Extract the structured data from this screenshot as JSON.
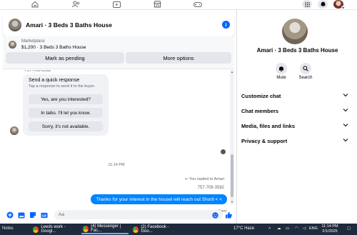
{
  "colors": {
    "accent": "#0866ff",
    "bubble_out": "#0084ff",
    "taskbar": "#1f2a3c",
    "muted": "#65676b",
    "button_bg": "#e4e6eb"
  },
  "topnav": {
    "icons": [
      "home-icon",
      "friends-icon",
      "video-icon",
      "marketplace-icon",
      "gaming-icon",
      "menu-grid-icon",
      "notifications-icon",
      "profile-avatar"
    ]
  },
  "chat": {
    "title": "Amari · 3 Beds 3 Baths House",
    "marketplace_label": "Marketplace",
    "listing_price_title": "$1,200 · 3 Beds 3 Baths House",
    "mark_pending_label": "Mark as pending",
    "more_options_label": "More options",
    "partial_phone": "757-708-3582",
    "quick_response": {
      "title": "Send a quick response",
      "subtitle": "Tap a response to send it to the buyer.",
      "options": [
        "Yes, are you interested?",
        "In talks. I'll let you know.",
        "Sorry, it's not available."
      ]
    },
    "timestamp": "11:14 PM",
    "replied_to": "You replied to Amari",
    "replied_phone": "757-708-3582",
    "outgoing_message": "Thanks for your interest in the housel will reach out Shortl < <",
    "sent_label": "Sent",
    "composer_placeholder": "Aa"
  },
  "info": {
    "name": "Amari · 3 Beds 3 Baths House",
    "actions": [
      {
        "label": "Mute",
        "icon": "bell-icon"
      },
      {
        "label": "Search",
        "icon": "search-icon"
      }
    ],
    "sections": [
      "Customize chat",
      "Chat members",
      "Media, files and links",
      "Privacy & support"
    ]
  },
  "taskbar": {
    "notes": "Notes",
    "items": [
      {
        "label": "Leeds work - Googl...",
        "icon": "chrome-icon"
      },
      {
        "label": "(4) Messenger | Fac...",
        "icon": "chrome-icon"
      },
      {
        "label": "(2) Facebook - Goo...",
        "icon": "chrome-icon"
      }
    ],
    "weather": "17°C  Haze",
    "lang": "ENG",
    "time": "11:14 PM",
    "date": "2/1/2025"
  }
}
